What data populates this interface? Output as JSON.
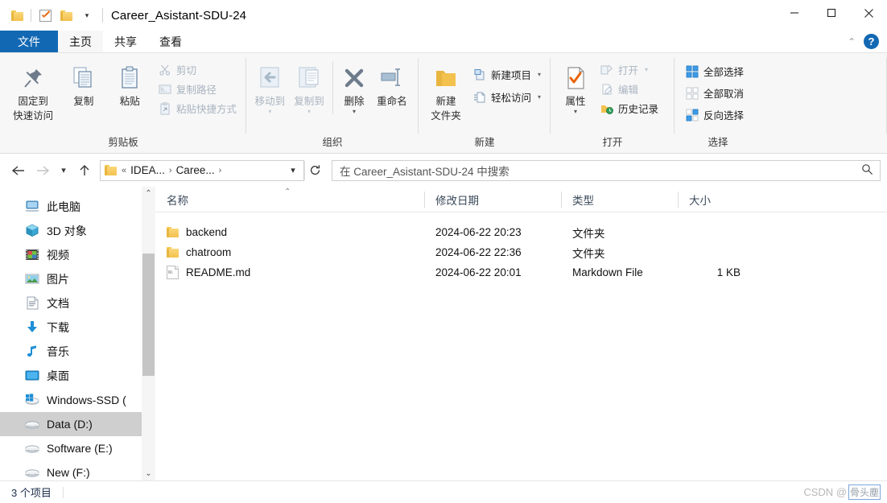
{
  "window": {
    "title": "Career_Asistant-SDU-24",
    "quick_access": [
      "folder-icon",
      "properties-check-icon",
      "new-folder-icon"
    ],
    "controls": {
      "minimize": "minimize-icon",
      "maximize": "maximize-icon",
      "close": "close-icon"
    }
  },
  "tabs": [
    {
      "id": "file",
      "label": "文件"
    },
    {
      "id": "home",
      "label": "主页"
    },
    {
      "id": "share",
      "label": "共享"
    },
    {
      "id": "view",
      "label": "查看"
    }
  ],
  "tab_right": {
    "collapse": "chevron-up-icon",
    "help": "?"
  },
  "ribbon": {
    "groups": [
      {
        "name": "clipboard",
        "title": "剪贴板",
        "big": [
          {
            "name": "pin-to-quick-access",
            "label_line1": "固定到",
            "label_line2": "快速访问",
            "icon": "pin-icon",
            "disabled": false
          },
          {
            "name": "copy",
            "label_line1": "复制",
            "label_line2": "",
            "icon": "copy-icon",
            "disabled": false
          },
          {
            "name": "paste",
            "label_line1": "粘贴",
            "label_line2": "",
            "icon": "paste-icon",
            "disabled": false
          }
        ],
        "small": [
          {
            "name": "cut",
            "label": "剪切",
            "icon": "scissors-icon",
            "disabled": true
          },
          {
            "name": "copy-path",
            "label": "复制路径",
            "icon": "copy-path-icon",
            "disabled": true
          },
          {
            "name": "paste-shortcut",
            "label": "粘贴快捷方式",
            "icon": "paste-shortcut-icon",
            "disabled": true
          }
        ]
      },
      {
        "name": "organize",
        "title": "组织",
        "big": [
          {
            "name": "move-to",
            "label_line1": "移动到",
            "label_line2": "",
            "icon": "move-to-icon",
            "disabled": true,
            "caret": true
          },
          {
            "name": "copy-to",
            "label_line1": "复制到",
            "label_line2": "",
            "icon": "copy-to-icon",
            "disabled": true,
            "caret": true
          },
          {
            "name": "delete",
            "label_line1": "删除",
            "label_line2": "",
            "icon": "delete-x-icon",
            "disabled": false,
            "caret": true
          },
          {
            "name": "rename",
            "label_line1": "重命名",
            "label_line2": "",
            "icon": "rename-icon",
            "disabled": false
          }
        ],
        "small": []
      },
      {
        "name": "new",
        "title": "新建",
        "big": [
          {
            "name": "new-folder",
            "label_line1": "新建",
            "label_line2": "文件夹",
            "icon": "new-folder-icon",
            "disabled": false
          }
        ],
        "small": [
          {
            "name": "new-item",
            "label": "新建项目",
            "icon": "new-item-icon",
            "disabled": false,
            "caret": true
          },
          {
            "name": "easy-access",
            "label": "轻松访问",
            "icon": "easy-access-icon",
            "disabled": false,
            "caret": true
          }
        ]
      },
      {
        "name": "open",
        "title": "打开",
        "big": [
          {
            "name": "properties",
            "label_line1": "属性",
            "label_line2": "",
            "icon": "properties-icon",
            "disabled": false,
            "caret": true
          }
        ],
        "small": [
          {
            "name": "open",
            "label": "打开",
            "icon": "open-icon",
            "disabled": true,
            "caret": true
          },
          {
            "name": "edit",
            "label": "编辑",
            "icon": "edit-icon",
            "disabled": true
          },
          {
            "name": "history",
            "label": "历史记录",
            "icon": "history-icon",
            "disabled": false
          }
        ]
      },
      {
        "name": "select",
        "title": "选择",
        "big": [],
        "small": [
          {
            "name": "select-all",
            "label": "全部选择",
            "icon": "select-all-icon",
            "disabled": false
          },
          {
            "name": "select-none",
            "label": "全部取消",
            "icon": "select-none-icon",
            "disabled": false
          },
          {
            "name": "invert-selection",
            "label": "反向选择",
            "icon": "invert-selection-icon",
            "disabled": false
          }
        ]
      }
    ]
  },
  "addressbar": {
    "back": "back-arrow-icon",
    "forward": "forward-arrow-icon",
    "recent": "chevron-down-icon",
    "up": "up-arrow-icon",
    "crumb_prefix": "«",
    "crumbs": [
      "IDEA...",
      "Caree..."
    ],
    "crumb_sep": "›",
    "dropdown": "chevron-down-icon",
    "refresh": "refresh-icon"
  },
  "search": {
    "placeholder": "在 Career_Asistant-SDU-24 中搜索",
    "icon": "search-icon"
  },
  "navpane": {
    "items": [
      {
        "label": "此电脑",
        "icon": "this-pc-icon",
        "selected": false
      },
      {
        "label": "3D 对象",
        "icon": "3d-objects-icon",
        "selected": false
      },
      {
        "label": "视频",
        "icon": "videos-icon",
        "selected": false
      },
      {
        "label": "图片",
        "icon": "pictures-icon",
        "selected": false
      },
      {
        "label": "文档",
        "icon": "documents-icon",
        "selected": false
      },
      {
        "label": "下载",
        "icon": "downloads-icon",
        "selected": false
      },
      {
        "label": "音乐",
        "icon": "music-icon",
        "selected": false
      },
      {
        "label": "桌面",
        "icon": "desktop-icon",
        "selected": false
      },
      {
        "label": "Windows-SSD (",
        "icon": "windows-drive-icon",
        "selected": false
      },
      {
        "label": "Data (D:)",
        "icon": "drive-icon",
        "selected": true
      },
      {
        "label": "Software (E:)",
        "icon": "drive-icon",
        "selected": false
      },
      {
        "label": "New (F:)",
        "icon": "drive-icon",
        "selected": false
      }
    ],
    "scroll_up": "chevron-up-icon",
    "scroll_down": "chevron-down-icon"
  },
  "filelist": {
    "columns": [
      {
        "key": "name",
        "label": "名称",
        "sorted": true,
        "sort_dir": "asc"
      },
      {
        "key": "date",
        "label": "修改日期"
      },
      {
        "key": "type",
        "label": "类型"
      },
      {
        "key": "size",
        "label": "大小"
      }
    ],
    "rows": [
      {
        "name": "backend",
        "date": "2024-06-22 20:23",
        "type": "文件夹",
        "size": "",
        "icon": "folder-icon"
      },
      {
        "name": "chatroom",
        "date": "2024-06-22 22:36",
        "type": "文件夹",
        "size": "",
        "icon": "folder-icon"
      },
      {
        "name": "README.md",
        "date": "2024-06-22 20:01",
        "type": "Markdown File",
        "size": "1 KB",
        "icon": "markdown-file-icon"
      }
    ]
  },
  "statusbar": {
    "item_count": "3 个项目",
    "watermark_prefix": "CSDN @",
    "watermark_name": "骨头塵"
  },
  "colors": {
    "accent": "#1268b3",
    "folder": "#f3c14e",
    "selection": "#cfcfcf",
    "ribbon_bg": "#f7f7f7",
    "header_text": "#3b4a5a"
  }
}
